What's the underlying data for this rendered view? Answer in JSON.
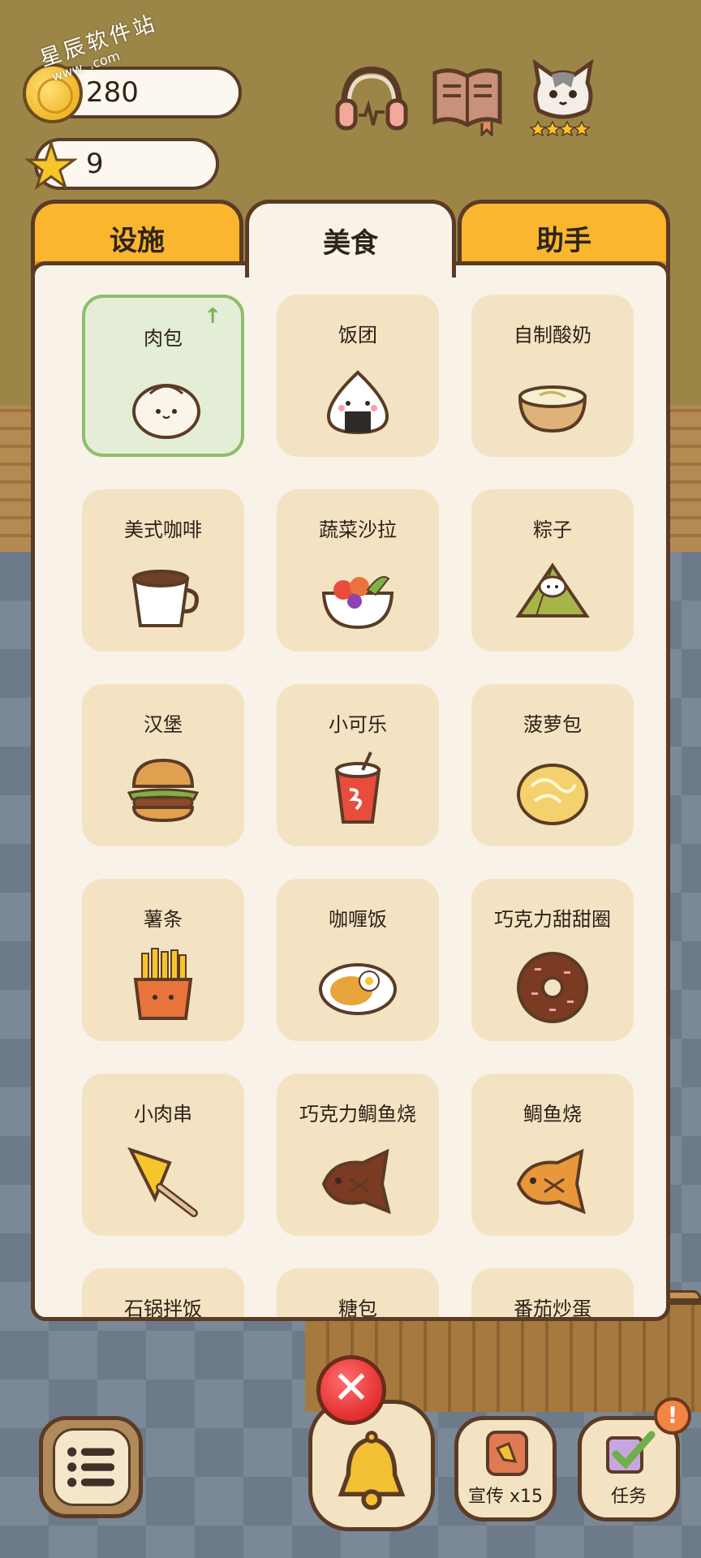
{
  "watermark": {
    "title": "星辰软件站",
    "sub": "www.   .com"
  },
  "hud": {
    "coins": "280",
    "stars": "9"
  },
  "tabs": [
    {
      "label": "设施",
      "active": false
    },
    {
      "label": "美食",
      "active": true
    },
    {
      "label": "助手",
      "active": false
    }
  ],
  "foods": [
    {
      "label": "肉包",
      "icon": "steamed-bun-icon",
      "selected": true,
      "upgrade": "↑"
    },
    {
      "label": "饭团",
      "icon": "onigiri-icon"
    },
    {
      "label": "自制酸奶",
      "icon": "yogurt-icon"
    },
    {
      "label": "美式咖啡",
      "icon": "coffee-cup-icon"
    },
    {
      "label": "蔬菜沙拉",
      "icon": "salad-bowl-icon"
    },
    {
      "label": "粽子",
      "icon": "zongzi-icon"
    },
    {
      "label": "汉堡",
      "icon": "burger-icon"
    },
    {
      "label": "小可乐",
      "icon": "cola-cup-icon"
    },
    {
      "label": "菠萝包",
      "icon": "pineapple-bun-icon"
    },
    {
      "label": "薯条",
      "icon": "fries-icon"
    },
    {
      "label": "咖喱饭",
      "icon": "curry-rice-icon"
    },
    {
      "label": "巧克力甜甜圈",
      "icon": "chocolate-donut-icon"
    },
    {
      "label": "小肉串",
      "icon": "skewer-icon"
    },
    {
      "label": "巧克力鲷鱼烧",
      "icon": "chocolate-taiyaki-icon"
    },
    {
      "label": "鲷鱼烧",
      "icon": "taiyaki-icon"
    },
    {
      "label": "石锅拌饭",
      "icon": "bibimbap-icon"
    },
    {
      "label": "糖包",
      "icon": "sugar-bun-icon"
    },
    {
      "label": "番茄炒蛋",
      "icon": "tomato-egg-icon"
    }
  ],
  "bottom": {
    "promo_label": "宣传 x15",
    "task_label": "任务",
    "close_symbol": "✕",
    "alert_symbol": "!"
  },
  "colors": {
    "tab_active": "#f8f2e8",
    "tab_inactive": "#f9b62e",
    "card": "#f4e3c3",
    "card_selected": "#e4eed6",
    "outline": "#5b3b26"
  }
}
